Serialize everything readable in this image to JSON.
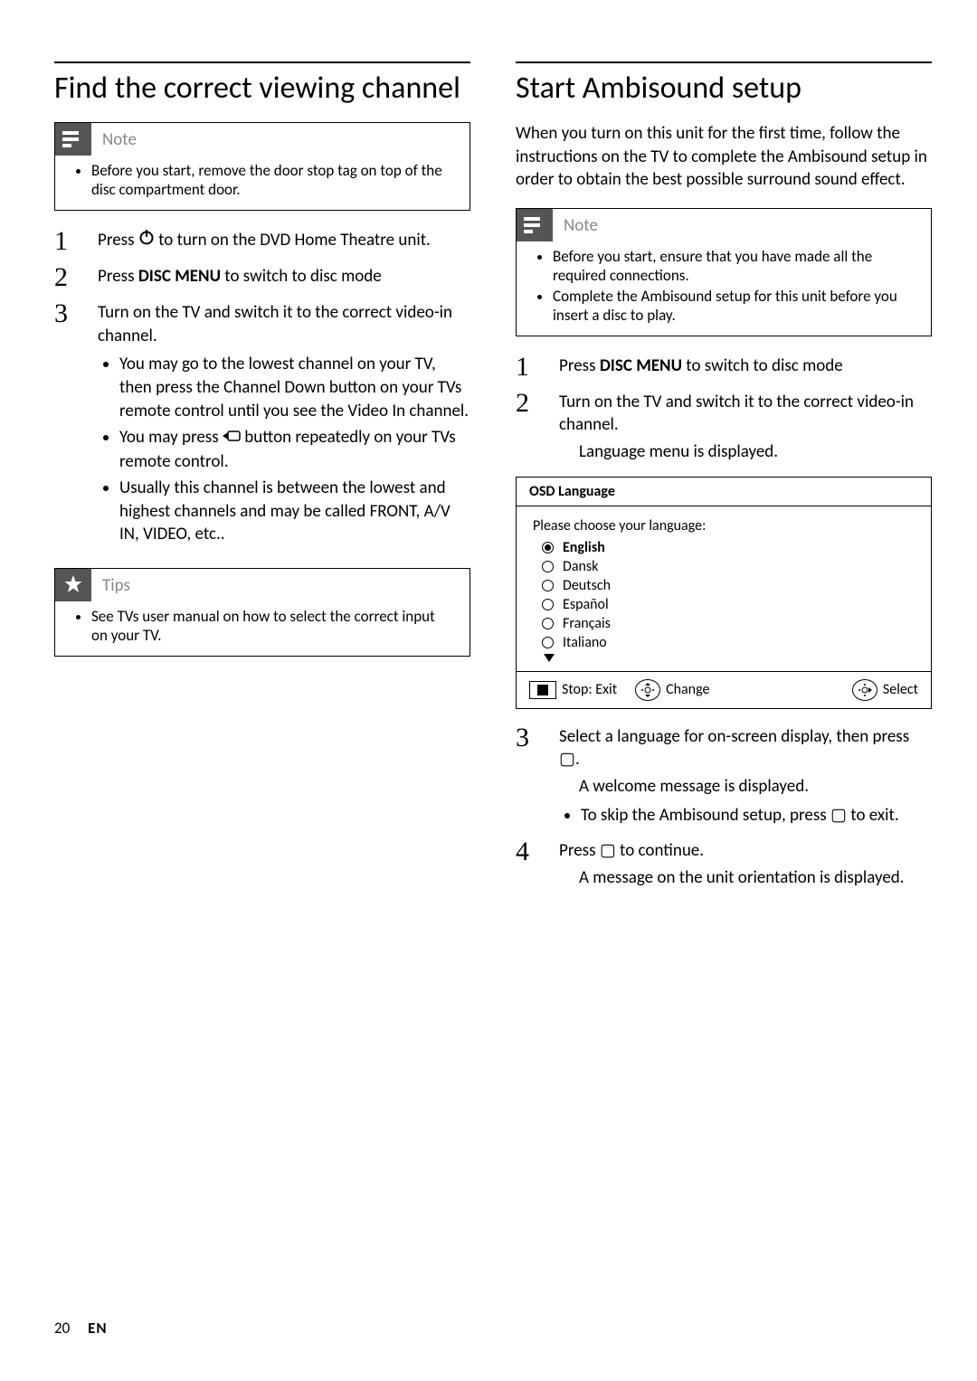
{
  "left": {
    "title": "Find the correct viewing channel",
    "note": {
      "label": "Note",
      "items": [
        "Before you start, remove the door stop tag on top of the disc compartment door."
      ]
    },
    "steps": [
      {
        "pre": "Press ",
        "icon": "power",
        "post": " to turn on the DVD Home Theatre unit."
      },
      {
        "pre": "Press ",
        "strong": "DISC MENU",
        "post": " to switch to disc mode"
      },
      {
        "text": "Turn on the TV and switch it to the correct video-in channel.",
        "sub": [
          "You may go to the lowest channel on your TV, then press the Channel Down button on your TVs remote control until you see the Video In channel.",
          {
            "pre": "You may press ",
            "icon": "source",
            "post": " button repeatedly on your TVs remote control."
          },
          "Usually this channel is between the lowest and highest channels and may be called FRONT, A/V IN, VIDEO, etc.."
        ]
      }
    ],
    "tips": {
      "label": "Tips",
      "items": [
        "See TVs user manual on how to select the correct input on your TV."
      ]
    }
  },
  "right": {
    "title": "Start Ambisound setup",
    "intro": "When you turn on this unit for the first time, follow the instructions on the TV to complete the Ambisound setup in order to obtain the best possible surround sound effect.",
    "note": {
      "label": "Note",
      "items": [
        "Before you start, ensure that you have made all the required connections.",
        "Complete the Ambisound setup for this unit before you insert a disc to play."
      ]
    },
    "steps_a": [
      {
        "pre": "Press ",
        "strong": "DISC MENU",
        "post": " to switch to disc mode"
      },
      {
        "text": "Turn on the TV and switch it to the correct video-in channel.",
        "result": "Language menu is displayed."
      }
    ],
    "osd": {
      "title": "OSD Language",
      "prompt": "Please choose your language:",
      "options": [
        {
          "label": "English",
          "selected": true
        },
        {
          "label": "Dansk",
          "selected": false
        },
        {
          "label": "Deutsch",
          "selected": false
        },
        {
          "label": "Español",
          "selected": false
        },
        {
          "label": "Français",
          "selected": false
        },
        {
          "label": "Italiano",
          "selected": false
        }
      ],
      "foot": {
        "stop": "Stop: Exit",
        "change": "Change",
        "select": "Select"
      }
    },
    "steps_b": [
      {
        "pre": "Select a language for on-screen display, then press ",
        "glyph": "▢",
        "post": ".",
        "result": "A welcome message is displayed.",
        "sub": [
          {
            "pre": "To skip the Ambisound setup, press ",
            "glyph": "▢",
            "post": " to exit."
          }
        ]
      },
      {
        "pre": "Press ",
        "glyph": "▢",
        "post": " to continue.",
        "result": "A message on the unit orientation is displayed."
      }
    ]
  },
  "footer": {
    "page": "20",
    "lang": "EN"
  }
}
